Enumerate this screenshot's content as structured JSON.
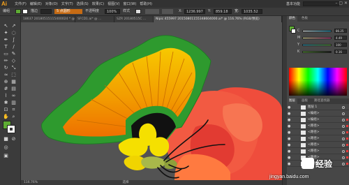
{
  "app": {
    "logo": "Ai",
    "menus": [
      "文件(F)",
      "编辑(E)",
      "对象(O)",
      "文字(T)",
      "选择(S)",
      "效果(C)",
      "视图(V)",
      "窗口(W)",
      "帮助(H)"
    ],
    "workspace": "基本功能"
  },
  "control_bar": {
    "selection_label": "编组",
    "fill_color": "#5eac34",
    "stroke_label": "描边",
    "stroke_weight": "",
    "brush_label": "5 点圆形",
    "opacity_label": "不透明度",
    "opacity_value": "100%",
    "style_label": "样式",
    "x_label": "X:",
    "x_value": "1236.997",
    "y_label": "Y:",
    "y_value": "859.18",
    "w_label": "宽:",
    "w_value": "1035.52"
  },
  "tabs": [
    {
      "label": "18637 20180515115400024 * @...",
      "active": false
    },
    {
      "label": "SFCD1.ai*  @ ...",
      "active": false
    },
    {
      "label": "SZR 20180515C ...",
      "active": false
    },
    {
      "label": "Nipic 455997 20150801155348604000.ai* @ 116.76% (RGB/预览)",
      "active": true
    }
  ],
  "status": {
    "zoom": "116.76%",
    "tool": "选择"
  },
  "panels": {
    "color_tabs": [
      "颜色",
      "色板"
    ],
    "color_sliders": [
      {
        "label": "C",
        "value": "86.25",
        "color": "#14a0c8"
      },
      {
        "label": "M",
        "value": "4.49",
        "color": "#d43a8a"
      },
      {
        "label": "Y",
        "value": "100",
        "color": "#e8d820"
      },
      {
        "label": "K",
        "value": "0.16",
        "color": "#666666"
      }
    ],
    "layer_tabs": [
      "图层",
      "画板",
      "路径查找器"
    ],
    "layers": [
      {
        "label": "图层 1",
        "selected": false
      },
      {
        "label": "<编组>",
        "selected": false
      },
      {
        "label": "<编组>",
        "selected": true
      },
      {
        "label": "<路径>",
        "selected": true
      },
      {
        "label": "<路径>",
        "selected": true
      },
      {
        "label": "<路径>",
        "selected": true
      },
      {
        "label": "<路径>",
        "selected": true
      },
      {
        "label": "<路径>",
        "selected": true
      },
      {
        "label": "<路径>",
        "selected": true
      },
      {
        "label": "<路径>",
        "selected": true
      }
    ]
  },
  "artwork": {
    "outer_wing_color": "#2e9a2e",
    "inner_wing_top": "#f7c800",
    "inner_wing_bottom": "#ee7000",
    "body_yellow": "#f5e000",
    "flower_color": "#f25a42"
  },
  "watermark": {
    "text": "经验",
    "url": "jingyan.baidu.com"
  }
}
